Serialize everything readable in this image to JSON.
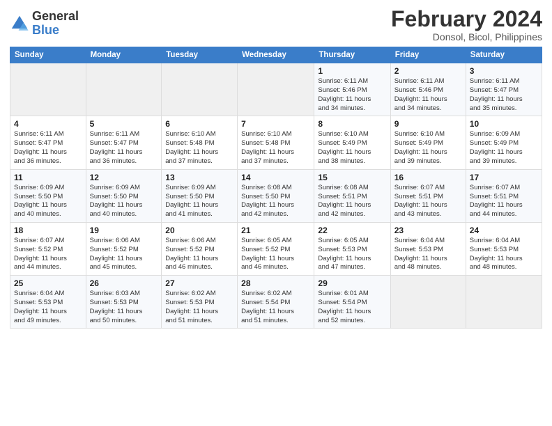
{
  "header": {
    "logo_general": "General",
    "logo_blue": "Blue",
    "month_title": "February 2024",
    "location": "Donsol, Bicol, Philippines"
  },
  "weekdays": [
    "Sunday",
    "Monday",
    "Tuesday",
    "Wednesday",
    "Thursday",
    "Friday",
    "Saturday"
  ],
  "weeks": [
    [
      {
        "day": "",
        "info": ""
      },
      {
        "day": "",
        "info": ""
      },
      {
        "day": "",
        "info": ""
      },
      {
        "day": "",
        "info": ""
      },
      {
        "day": "1",
        "info": "Sunrise: 6:11 AM\nSunset: 5:46 PM\nDaylight: 11 hours\nand 34 minutes."
      },
      {
        "day": "2",
        "info": "Sunrise: 6:11 AM\nSunset: 5:46 PM\nDaylight: 11 hours\nand 34 minutes."
      },
      {
        "day": "3",
        "info": "Sunrise: 6:11 AM\nSunset: 5:47 PM\nDaylight: 11 hours\nand 35 minutes."
      }
    ],
    [
      {
        "day": "4",
        "info": "Sunrise: 6:11 AM\nSunset: 5:47 PM\nDaylight: 11 hours\nand 36 minutes."
      },
      {
        "day": "5",
        "info": "Sunrise: 6:11 AM\nSunset: 5:47 PM\nDaylight: 11 hours\nand 36 minutes."
      },
      {
        "day": "6",
        "info": "Sunrise: 6:10 AM\nSunset: 5:48 PM\nDaylight: 11 hours\nand 37 minutes."
      },
      {
        "day": "7",
        "info": "Sunrise: 6:10 AM\nSunset: 5:48 PM\nDaylight: 11 hours\nand 37 minutes."
      },
      {
        "day": "8",
        "info": "Sunrise: 6:10 AM\nSunset: 5:49 PM\nDaylight: 11 hours\nand 38 minutes."
      },
      {
        "day": "9",
        "info": "Sunrise: 6:10 AM\nSunset: 5:49 PM\nDaylight: 11 hours\nand 39 minutes."
      },
      {
        "day": "10",
        "info": "Sunrise: 6:09 AM\nSunset: 5:49 PM\nDaylight: 11 hours\nand 39 minutes."
      }
    ],
    [
      {
        "day": "11",
        "info": "Sunrise: 6:09 AM\nSunset: 5:50 PM\nDaylight: 11 hours\nand 40 minutes."
      },
      {
        "day": "12",
        "info": "Sunrise: 6:09 AM\nSunset: 5:50 PM\nDaylight: 11 hours\nand 40 minutes."
      },
      {
        "day": "13",
        "info": "Sunrise: 6:09 AM\nSunset: 5:50 PM\nDaylight: 11 hours\nand 41 minutes."
      },
      {
        "day": "14",
        "info": "Sunrise: 6:08 AM\nSunset: 5:50 PM\nDaylight: 11 hours\nand 42 minutes."
      },
      {
        "day": "15",
        "info": "Sunrise: 6:08 AM\nSunset: 5:51 PM\nDaylight: 11 hours\nand 42 minutes."
      },
      {
        "day": "16",
        "info": "Sunrise: 6:07 AM\nSunset: 5:51 PM\nDaylight: 11 hours\nand 43 minutes."
      },
      {
        "day": "17",
        "info": "Sunrise: 6:07 AM\nSunset: 5:51 PM\nDaylight: 11 hours\nand 44 minutes."
      }
    ],
    [
      {
        "day": "18",
        "info": "Sunrise: 6:07 AM\nSunset: 5:52 PM\nDaylight: 11 hours\nand 44 minutes."
      },
      {
        "day": "19",
        "info": "Sunrise: 6:06 AM\nSunset: 5:52 PM\nDaylight: 11 hours\nand 45 minutes."
      },
      {
        "day": "20",
        "info": "Sunrise: 6:06 AM\nSunset: 5:52 PM\nDaylight: 11 hours\nand 46 minutes."
      },
      {
        "day": "21",
        "info": "Sunrise: 6:05 AM\nSunset: 5:52 PM\nDaylight: 11 hours\nand 46 minutes."
      },
      {
        "day": "22",
        "info": "Sunrise: 6:05 AM\nSunset: 5:53 PM\nDaylight: 11 hours\nand 47 minutes."
      },
      {
        "day": "23",
        "info": "Sunrise: 6:04 AM\nSunset: 5:53 PM\nDaylight: 11 hours\nand 48 minutes."
      },
      {
        "day": "24",
        "info": "Sunrise: 6:04 AM\nSunset: 5:53 PM\nDaylight: 11 hours\nand 48 minutes."
      }
    ],
    [
      {
        "day": "25",
        "info": "Sunrise: 6:04 AM\nSunset: 5:53 PM\nDaylight: 11 hours\nand 49 minutes."
      },
      {
        "day": "26",
        "info": "Sunrise: 6:03 AM\nSunset: 5:53 PM\nDaylight: 11 hours\nand 50 minutes."
      },
      {
        "day": "27",
        "info": "Sunrise: 6:02 AM\nSunset: 5:53 PM\nDaylight: 11 hours\nand 51 minutes."
      },
      {
        "day": "28",
        "info": "Sunrise: 6:02 AM\nSunset: 5:54 PM\nDaylight: 11 hours\nand 51 minutes."
      },
      {
        "day": "29",
        "info": "Sunrise: 6:01 AM\nSunset: 5:54 PM\nDaylight: 11 hours\nand 52 minutes."
      },
      {
        "day": "",
        "info": ""
      },
      {
        "day": "",
        "info": ""
      }
    ]
  ]
}
